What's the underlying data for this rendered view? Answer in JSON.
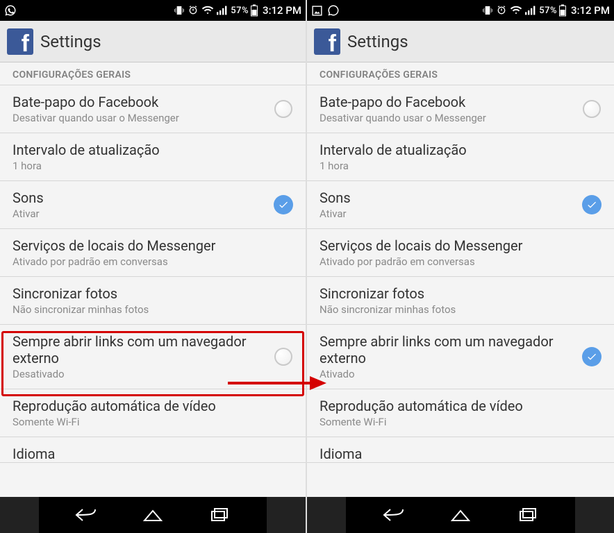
{
  "statusbar": {
    "battery_pct": "57%",
    "time": "3:12 PM"
  },
  "header": {
    "title": "Settings"
  },
  "list": {
    "section_header": "CONFIGURAÇÕES GERAIS",
    "items": [
      {
        "title": "Bate-papo do Facebook",
        "sub": "Desativar quando usar o Messenger",
        "control": "radio-off"
      },
      {
        "title": "Intervalo de atualização",
        "sub": "1 hora",
        "control": "none"
      },
      {
        "title": "Sons",
        "sub": "Ativar",
        "control": "check-on"
      },
      {
        "title": "Serviços de locais do Messenger",
        "sub": "Ativado por padrão em conversas",
        "control": "none"
      },
      {
        "title": "Sincronizar fotos",
        "sub": "Não sincronizar minhas fotos",
        "control": "none"
      },
      {
        "title": "Sempre abrir links com um navegador externo",
        "sub_a": "Desativado",
        "sub_b": "Ativado"
      },
      {
        "title": "Reprodução automática de vídeo",
        "sub": "Somente Wi-Fi",
        "control": "none"
      },
      {
        "title": "Idioma",
        "sub": "",
        "control": "none"
      }
    ]
  }
}
